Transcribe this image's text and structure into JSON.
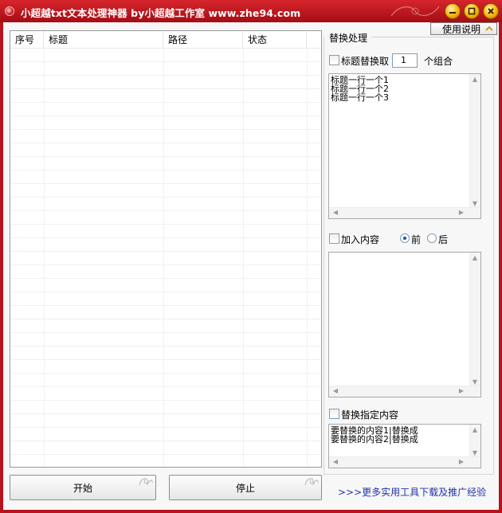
{
  "window": {
    "title": "小超越txt文本处理神器 by小超越工作室 www.zhe94.com"
  },
  "toolbar": {
    "help_label": "使用说明"
  },
  "list": {
    "columns": [
      "序号",
      "标题",
      "路径",
      "状态"
    ]
  },
  "replace_section": {
    "title": "替换处理",
    "title_replace_label": "标题替换取",
    "group_count": "1",
    "group_suffix": "个组合",
    "title_lines": "标题一行一个1\n标题一行一个2\n标题一行一个3"
  },
  "insert_section": {
    "label": "加入内容",
    "front_label": "前",
    "back_label": "后",
    "front_selected": true
  },
  "replace_specified": {
    "label": "替换指定内容",
    "lines": "要替换的内容1|替换成\n要替换的内容2|替换成"
  },
  "actions": {
    "start_label": "开始",
    "stop_label": "停止",
    "more_link": ">>>更多实用工具下载及推广经验"
  },
  "colors": {
    "titlebar": "#b8121b",
    "link": "#2233aa"
  }
}
